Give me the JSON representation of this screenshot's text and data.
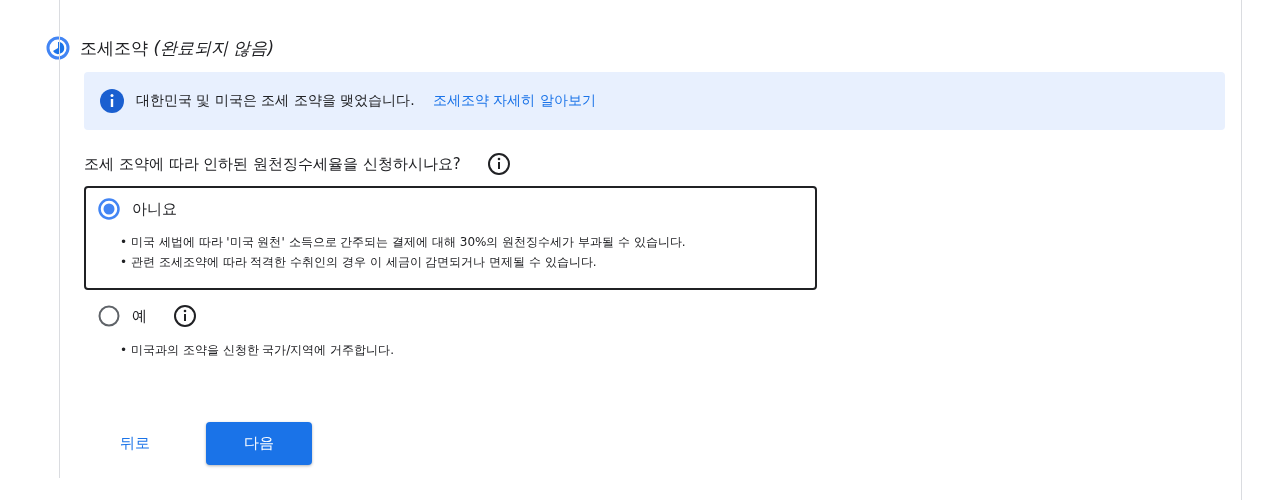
{
  "step": {
    "title": "조세조약",
    "status": "(완료되지 않음)"
  },
  "notice": {
    "text": "대한민국 및 미국은 조세 조약을 맺었습니다.",
    "link": "조세조약 자세히 알아보기"
  },
  "question": {
    "text": "조세 조약에 따라 인하된 원천징수세율을 신청하시나요?",
    "help_icon": true
  },
  "options": [
    {
      "label": "아니요",
      "selected": true,
      "help_icon": false,
      "bullets": [
        "• 미국 세법에 따라 '미국 원천' 소득으로 간주되는 결제에 대해 30%의 원천징수세가 부과될 수 있습니다.",
        "• 관련 조세조약에 따라 적격한 수취인의 경우 이 세금이 감면되거나 면제될 수 있습니다."
      ]
    },
    {
      "label": "예",
      "selected": false,
      "help_icon": true,
      "bullets": [
        "• 미국과의 조약을 신청한 국가/지역에 거주합니다."
      ]
    }
  ],
  "buttons": {
    "back": "뒤로",
    "next": "다음"
  }
}
